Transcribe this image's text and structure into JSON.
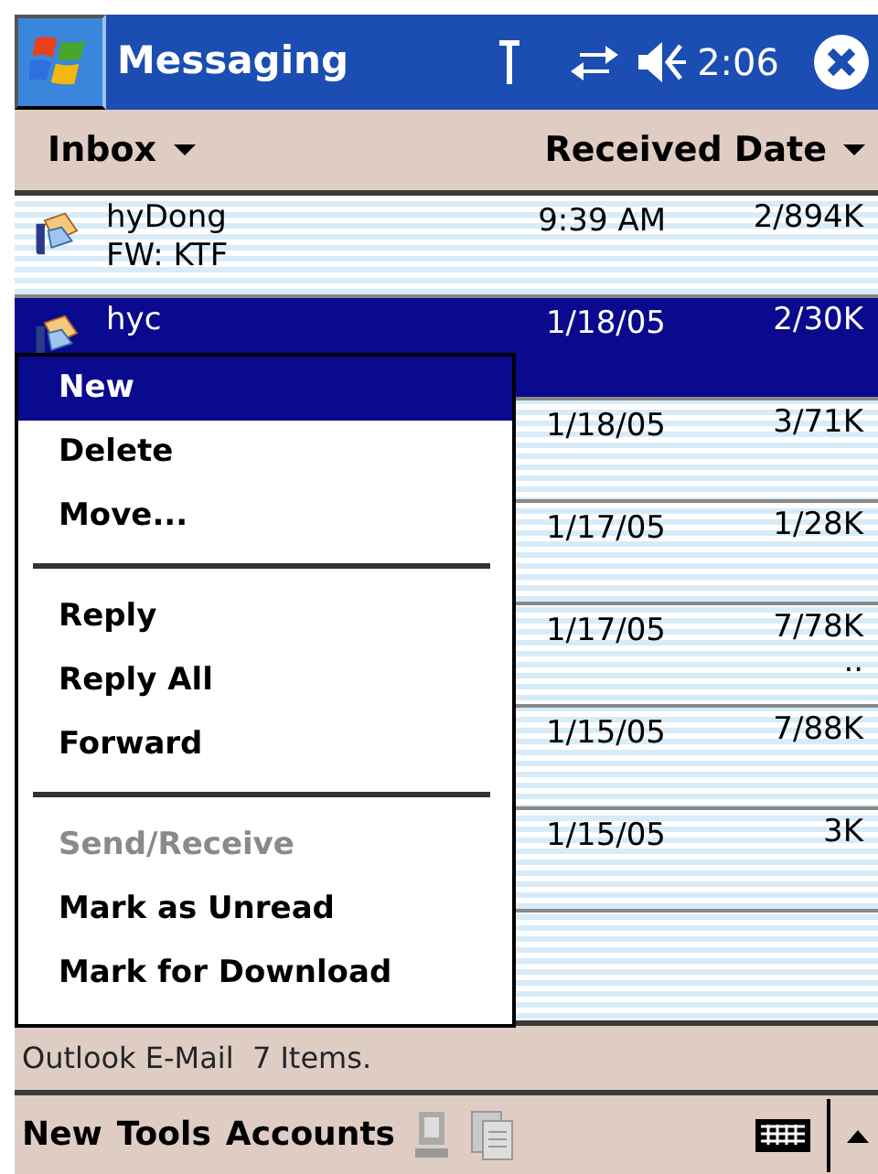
{
  "window": {
    "title": "Messaging",
    "time": "2:06"
  },
  "header": {
    "folder": "Inbox",
    "sort": "Received Date"
  },
  "messages": [
    {
      "sender": "hyDong",
      "subject": "FW: KTF",
      "date": "9:39 AM",
      "size": "2/894K",
      "selected": false
    },
    {
      "sender": "hyc",
      "date": "1/18/05",
      "size": "2/30K",
      "selected": true
    },
    {
      "date": "1/18/05",
      "size": "3/71K",
      "selected": false
    },
    {
      "date": "1/17/05",
      "size": "1/28K",
      "selected": false
    },
    {
      "date": "1/17/05",
      "size": "7/78K",
      "note": "..",
      "selected": false
    },
    {
      "date": "1/15/05",
      "size": "7/88K",
      "selected": false
    },
    {
      "date": "1/15/05",
      "size": "3K",
      "selected": false
    }
  ],
  "context_menu": {
    "items": [
      {
        "kind": "item",
        "label": "New",
        "selected": true,
        "disabled": false
      },
      {
        "kind": "item",
        "label": "Delete",
        "selected": false,
        "disabled": false
      },
      {
        "kind": "item",
        "label": "Move...",
        "selected": false,
        "disabled": false
      },
      {
        "kind": "separator"
      },
      {
        "kind": "item",
        "label": "Reply",
        "selected": false,
        "disabled": false
      },
      {
        "kind": "item",
        "label": "Reply All",
        "selected": false,
        "disabled": false
      },
      {
        "kind": "item",
        "label": "Forward",
        "selected": false,
        "disabled": false
      },
      {
        "kind": "separator"
      },
      {
        "kind": "item",
        "label": "Send/Receive",
        "selected": false,
        "disabled": true
      },
      {
        "kind": "item",
        "label": "Mark as Unread",
        "selected": false,
        "disabled": false
      },
      {
        "kind": "item",
        "label": "Mark for Download",
        "selected": false,
        "disabled": false
      }
    ]
  },
  "status_bar": "Outlook E-Mail  7 Items.",
  "toolbar": {
    "menus": [
      "New",
      "Tools",
      "Accounts"
    ]
  }
}
